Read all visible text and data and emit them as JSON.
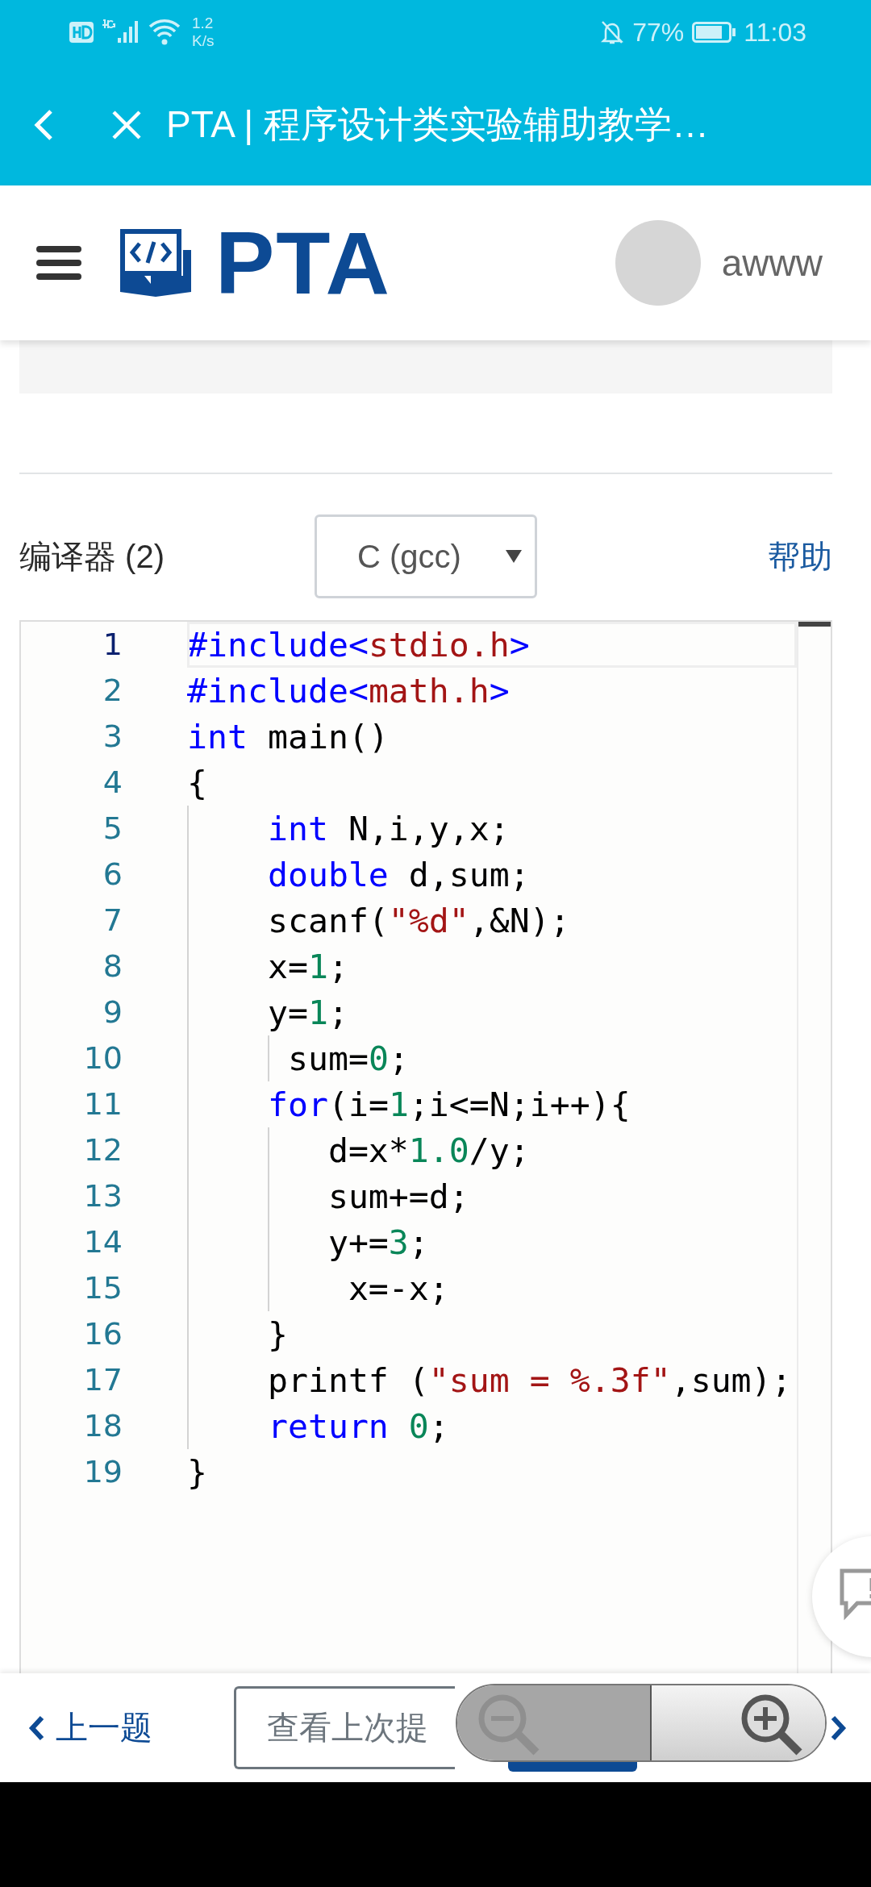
{
  "status_bar": {
    "speed": "1.2",
    "speed_unit": "K/s",
    "battery": "77%",
    "time": "11:03"
  },
  "title_bar": {
    "title": "PTA | 程序设计类实验辅助教学…"
  },
  "header": {
    "logo": "PTA",
    "username": "awww"
  },
  "compiler": {
    "label": "编译器 (2)",
    "value": "C (gcc)",
    "help": "帮助"
  },
  "editor": {
    "lines": [
      {
        "number": "1",
        "current": true,
        "tokens": [
          {
            "kind": "keyword",
            "text": "#include<"
          },
          {
            "kind": "string",
            "text": "stdio.h"
          },
          {
            "kind": "keyword",
            "text": ">"
          }
        ]
      },
      {
        "number": "2",
        "current": false,
        "tokens": [
          {
            "kind": "keyword",
            "text": "#include<"
          },
          {
            "kind": "string",
            "text": "math.h"
          },
          {
            "kind": "keyword",
            "text": ">"
          }
        ]
      },
      {
        "number": "3",
        "current": false,
        "tokens": [
          {
            "kind": "keyword",
            "text": "int"
          },
          {
            "kind": "plain",
            "text": " main()"
          }
        ]
      },
      {
        "number": "4",
        "current": false,
        "tokens": [
          {
            "kind": "plain",
            "text": "{"
          }
        ]
      },
      {
        "number": "5",
        "current": false,
        "tokens": [
          {
            "kind": "keyword",
            "text": "    int"
          },
          {
            "kind": "plain",
            "text": " N,i,y,x;"
          }
        ]
      },
      {
        "number": "6",
        "current": false,
        "tokens": [
          {
            "kind": "keyword",
            "text": "    double"
          },
          {
            "kind": "plain",
            "text": " d,sum;"
          }
        ]
      },
      {
        "number": "7",
        "current": false,
        "tokens": [
          {
            "kind": "plain",
            "text": "    scanf("
          },
          {
            "kind": "string",
            "text": "\"%d\""
          },
          {
            "kind": "plain",
            "text": ",&N);"
          }
        ]
      },
      {
        "number": "8",
        "current": false,
        "tokens": [
          {
            "kind": "plain",
            "text": "    x="
          },
          {
            "kind": "number",
            "text": "1"
          },
          {
            "kind": "plain",
            "text": ";"
          }
        ]
      },
      {
        "number": "9",
        "current": false,
        "tokens": [
          {
            "kind": "plain",
            "text": "    y="
          },
          {
            "kind": "number",
            "text": "1"
          },
          {
            "kind": "plain",
            "text": ";"
          }
        ]
      },
      {
        "number": "10",
        "current": false,
        "tokens": [
          {
            "kind": "plain",
            "text": "     sum="
          },
          {
            "kind": "number",
            "text": "0"
          },
          {
            "kind": "plain",
            "text": ";"
          }
        ]
      },
      {
        "number": "11",
        "current": false,
        "tokens": [
          {
            "kind": "keyword",
            "text": "    for"
          },
          {
            "kind": "plain",
            "text": "(i="
          },
          {
            "kind": "number",
            "text": "1"
          },
          {
            "kind": "plain",
            "text": ";i<=N;i++){"
          }
        ]
      },
      {
        "number": "12",
        "current": false,
        "tokens": [
          {
            "kind": "plain",
            "text": "       d=x*"
          },
          {
            "kind": "number",
            "text": "1.0"
          },
          {
            "kind": "plain",
            "text": "/y;"
          }
        ]
      },
      {
        "number": "13",
        "current": false,
        "tokens": [
          {
            "kind": "plain",
            "text": "       sum+=d;"
          }
        ]
      },
      {
        "number": "14",
        "current": false,
        "tokens": [
          {
            "kind": "plain",
            "text": "       y+="
          },
          {
            "kind": "number",
            "text": "3"
          },
          {
            "kind": "plain",
            "text": ";"
          }
        ]
      },
      {
        "number": "15",
        "current": false,
        "tokens": [
          {
            "kind": "plain",
            "text": "        x=-x;"
          }
        ]
      },
      {
        "number": "16",
        "current": false,
        "tokens": [
          {
            "kind": "plain",
            "text": "    }"
          }
        ]
      },
      {
        "number": "17",
        "current": false,
        "tokens": [
          {
            "kind": "plain",
            "text": "    printf ("
          },
          {
            "kind": "string",
            "text": "\"sum = %.3f\""
          },
          {
            "kind": "plain",
            "text": ",sum);"
          }
        ]
      },
      {
        "number": "18",
        "current": false,
        "tokens": [
          {
            "kind": "keyword",
            "text": "    return "
          },
          {
            "kind": "number",
            "text": "0"
          },
          {
            "kind": "plain",
            "text": ";"
          }
        ]
      },
      {
        "number": "19",
        "current": false,
        "tokens": [
          {
            "kind": "plain",
            "text": "}"
          }
        ]
      }
    ]
  },
  "bottom_bar": {
    "previous": "上一题",
    "last_submission": "查看上次提"
  }
}
